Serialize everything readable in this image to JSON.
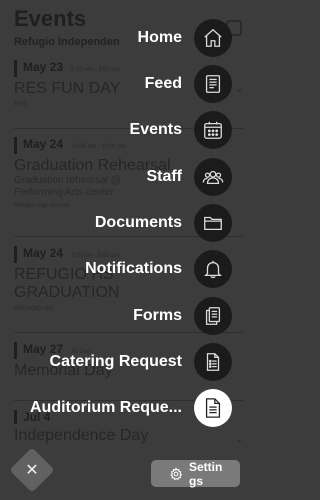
{
  "background": {
    "title": "Events",
    "subtitle": "Refugio Independen",
    "events": [
      {
        "date": "May 23",
        "time": "8:00 am - 3:00 pm",
        "name": "RES FUN DAY",
        "details": [],
        "note": "RES"
      },
      {
        "date": "May 24",
        "time": "10:00 am - 12:00 pm",
        "name": "Graduation Rehearsal",
        "details": [
          "Graduation rehearsal @",
          "Performing Arts center"
        ],
        "note": "Refugio High School"
      },
      {
        "date": "May 24",
        "time": "7:00 pm - 9:00 pm",
        "name": "REFUGIO HS",
        "details": [
          "GRADUATION"
        ],
        "note": "REFUGIO ISD"
      },
      {
        "date": "May 27",
        "time": "All Day",
        "name": "Memorial Day",
        "details": [],
        "note": ""
      },
      {
        "date": "Jul 4",
        "time": "",
        "name": "Independence Day",
        "details": [],
        "note": ""
      }
    ]
  },
  "menu": {
    "items": [
      {
        "label": "Home",
        "icon": "home-icon"
      },
      {
        "label": "Feed",
        "icon": "feed-icon"
      },
      {
        "label": "Events",
        "icon": "calendar-icon"
      },
      {
        "label": "Staff",
        "icon": "staff-icon"
      },
      {
        "label": "Documents",
        "icon": "folder-icon"
      },
      {
        "label": "Notifications",
        "icon": "bell-icon"
      },
      {
        "label": "Forms",
        "icon": "forms-icon"
      },
      {
        "label": "Catering Request",
        "icon": "document-list-icon"
      },
      {
        "label": "Auditorium Reque...",
        "icon": "document-icon"
      }
    ]
  },
  "controls": {
    "close_glyph": "✕",
    "settings_label": "Settings"
  },
  "colors": {
    "overlay_bg": "#3c3c3c",
    "icon_circle": "#1b1b1b",
    "icon_highlight": "#ffffff",
    "settings_button": "#7a7a7a",
    "close_button": "#616161"
  }
}
